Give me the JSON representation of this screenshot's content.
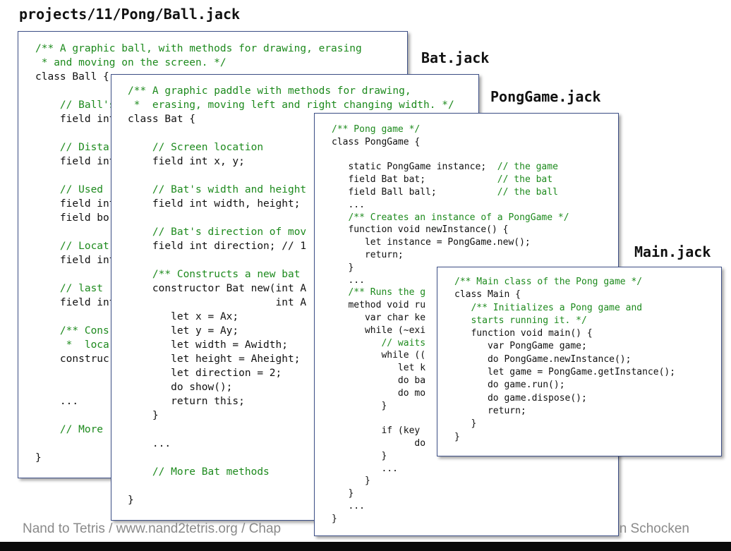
{
  "files": {
    "ball": {
      "title": "projects/11/Pong/Ball.jack",
      "lines": [
        {
          "t": "/** A graphic ball, with methods for drawing, erasing",
          "c": 1
        },
        {
          "t": " * and moving on the screen. */",
          "c": 1
        },
        {
          "t": "class Ball {",
          "c": 0
        },
        {
          "t": "",
          "c": 0
        },
        {
          "t": "    // Ball's",
          "c": 1
        },
        {
          "t": "    field int",
          "c": 0
        },
        {
          "t": "",
          "c": 0
        },
        {
          "t": "    // Dista",
          "c": 1
        },
        {
          "t": "    field int",
          "c": 0
        },
        {
          "t": "",
          "c": 0
        },
        {
          "t": "    // Used",
          "c": 1
        },
        {
          "t": "    field int",
          "c": 0
        },
        {
          "t": "    field bo",
          "c": 0
        },
        {
          "t": "",
          "c": 0
        },
        {
          "t": "    // Locat",
          "c": 1
        },
        {
          "t": "    field int",
          "c": 0
        },
        {
          "t": "",
          "c": 0
        },
        {
          "t": "    // last",
          "c": 1
        },
        {
          "t": "    field int",
          "c": 0
        },
        {
          "t": "",
          "c": 0
        },
        {
          "t": "    /** Cons",
          "c": 1
        },
        {
          "t": "     *  loca",
          "c": 1
        },
        {
          "t": "    construc",
          "c": 0
        },
        {
          "t": "",
          "c": 0
        },
        {
          "t": "",
          "c": 0
        },
        {
          "t": "    ...",
          "c": 0
        },
        {
          "t": "",
          "c": 0
        },
        {
          "t": "    // More",
          "c": 1
        },
        {
          "t": "",
          "c": 0
        },
        {
          "t": "}",
          "c": 0
        }
      ]
    },
    "bat": {
      "title": "Bat.jack",
      "lines": [
        {
          "t": "/** A graphic paddle with methods for drawing,",
          "c": 1
        },
        {
          "t": " *  erasing, moving left and right changing width. */",
          "c": 1
        },
        {
          "t": "class Bat {",
          "c": 0
        },
        {
          "t": "",
          "c": 0
        },
        {
          "t": "    // Screen location",
          "c": 1
        },
        {
          "t": "    field int x, y;",
          "c": 0
        },
        {
          "t": "",
          "c": 0
        },
        {
          "t": "    // Bat's width and height",
          "c": 1
        },
        {
          "t": "    field int width, height;",
          "c": 0
        },
        {
          "t": "",
          "c": 0
        },
        {
          "t": "    // Bat's direction of mov",
          "c": 1
        },
        {
          "t": "    field int direction; // 1",
          "c": 0
        },
        {
          "t": "",
          "c": 0
        },
        {
          "t": "    /** Constructs a new bat",
          "c": 1
        },
        {
          "t": "    constructor Bat new(int A",
          "c": 0
        },
        {
          "t": "                        int A",
          "c": 0
        },
        {
          "t": "       let x = Ax;",
          "c": 0
        },
        {
          "t": "       let y = Ay;",
          "c": 0
        },
        {
          "t": "       let width = Awidth;",
          "c": 0
        },
        {
          "t": "       let height = Aheight;",
          "c": 0
        },
        {
          "t": "       let direction = 2;",
          "c": 0
        },
        {
          "t": "       do show();",
          "c": 0
        },
        {
          "t": "       return this;",
          "c": 0
        },
        {
          "t": "    }",
          "c": 0
        },
        {
          "t": "",
          "c": 0
        },
        {
          "t": "    ...",
          "c": 0
        },
        {
          "t": "",
          "c": 0
        },
        {
          "t": "    // More Bat methods",
          "c": 1
        },
        {
          "t": "",
          "c": 0
        },
        {
          "t": "}",
          "c": 0
        }
      ]
    },
    "ponggame": {
      "title": "PongGame.jack",
      "lines": [
        {
          "t": "/** Pong game */",
          "c": 1
        },
        {
          "t": "class PongGame {",
          "c": 0
        },
        {
          "t": "",
          "c": 0
        },
        {
          "t": "   static PongGame instance;",
          "x": "  // the game"
        },
        {
          "t": "   field Bat bat;",
          "x": "             // the bat"
        },
        {
          "t": "   field Ball ball;",
          "x": "           // the ball"
        },
        {
          "t": "   ...",
          "c": 0
        },
        {
          "t": "   /** Creates an instance of a PongGame */",
          "c": 1
        },
        {
          "t": "   function void newInstance() {",
          "c": 0
        },
        {
          "t": "      let instance = PongGame.new();",
          "c": 0
        },
        {
          "t": "      return;",
          "c": 0
        },
        {
          "t": "   }",
          "c": 0
        },
        {
          "t": "   ...",
          "c": 0
        },
        {
          "t": "   /** Runs the g",
          "c": 1
        },
        {
          "t": "   method void ru",
          "c": 0
        },
        {
          "t": "      var char ke",
          "c": 0
        },
        {
          "t": "      while (~exi",
          "c": 0
        },
        {
          "t": "         // waits",
          "c": 1
        },
        {
          "t": "         while ((",
          "c": 0
        },
        {
          "t": "            let k",
          "c": 0
        },
        {
          "t": "            do ba",
          "c": 0
        },
        {
          "t": "            do mo",
          "c": 0
        },
        {
          "t": "         }",
          "c": 0
        },
        {
          "t": "",
          "c": 0
        },
        {
          "t": "         if (key",
          "c": 0
        },
        {
          "t": "               do",
          "c": 0
        },
        {
          "t": "         }",
          "c": 0
        },
        {
          "t": "         ...",
          "c": 0
        },
        {
          "t": "      }",
          "c": 0
        },
        {
          "t": "   }",
          "c": 0
        },
        {
          "t": "   ...",
          "c": 0
        },
        {
          "t": "}",
          "c": 0
        }
      ]
    },
    "main": {
      "title": "Main.jack",
      "lines": [
        {
          "t": "/** Main class of the Pong game */",
          "c": 1
        },
        {
          "t": "class Main {",
          "c": 0
        },
        {
          "t": "   /** Initializes a Pong game and",
          "c": 1
        },
        {
          "t": "   starts running it. */",
          "c": 1
        },
        {
          "t": "   function void main() {",
          "c": 0
        },
        {
          "t": "      var PongGame game;",
          "c": 0
        },
        {
          "t": "      do PongGame.newInstance();",
          "c": 0
        },
        {
          "t": "      let game = PongGame.getInstance();",
          "c": 0
        },
        {
          "t": "      do game.run();",
          "c": 0
        },
        {
          "t": "      do game.dispose();",
          "c": 0
        },
        {
          "t": "      return;",
          "c": 0
        },
        {
          "t": "   }",
          "c": 0
        },
        {
          "t": "}",
          "c": 0
        }
      ]
    }
  },
  "footer": {
    "left": "Nand to Tetris / www.nand2tetris.org / Chap",
    "right": "n Schocken"
  },
  "colors": {
    "comment": "#1d8a1d",
    "panel_border": "#3d4f86",
    "footer_text": "#8a8a8a",
    "code_text": "#111111"
  }
}
